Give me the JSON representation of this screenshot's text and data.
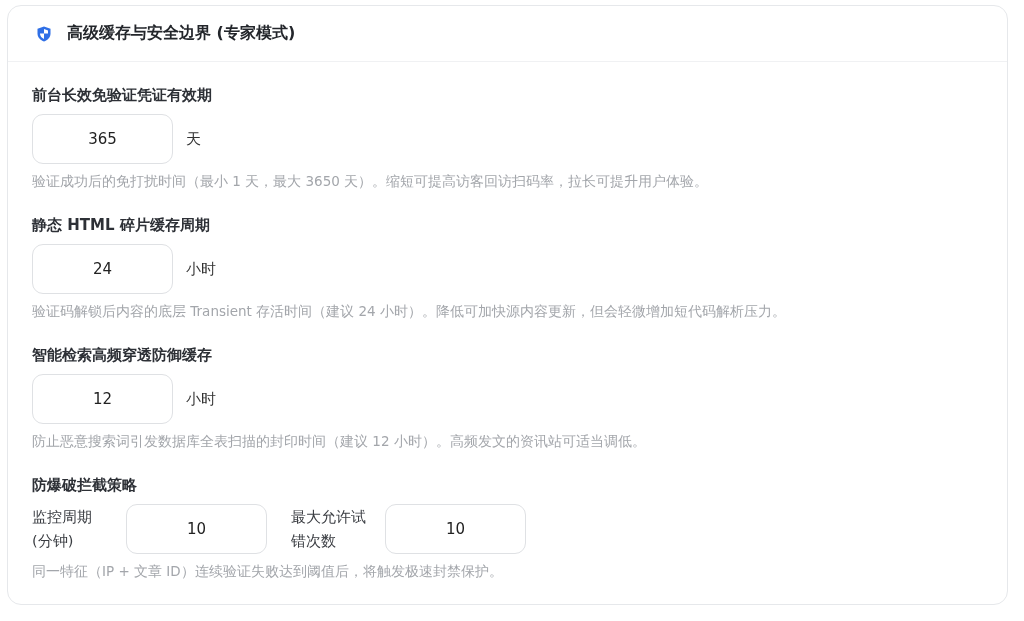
{
  "panel": {
    "title": "高级缓存与安全边界 (专家模式)"
  },
  "settings": [
    {
      "kind": "single",
      "label": "前台长效免验证凭证有效期",
      "value": "365",
      "unit": "天",
      "hint": "验证成功后的免打扰时间（最小 1 天，最大 3650 天）。缩短可提高访客回访扫码率，拉长可提升用户体验。"
    },
    {
      "kind": "single",
      "label": "静态 HTML 碎片缓存周期",
      "value": "24",
      "unit": "小时",
      "hint": "验证码解锁后内容的底层 Transient 存活时间（建议 24 小时）。降低可加快源内容更新，但会轻微增加短代码解析压力。"
    },
    {
      "kind": "single",
      "label": "智能检索高频穿透防御缓存",
      "value": "12",
      "unit": "小时",
      "hint": "防止恶意搜索词引发数据库全表扫描的封印时间（建议 12 小时）。高频发文的资讯站可适当调低。"
    },
    {
      "kind": "pair",
      "label": "防爆破拦截策略",
      "fields": [
        {
          "label": "监控周期(分钟)",
          "value": "10"
        },
        {
          "label": "最大允许试错次数",
          "value": "10"
        }
      ],
      "hint": "同一特征（IP + 文章 ID）连续验证失败达到阈值后，将触发极速封禁保护。"
    }
  ]
}
